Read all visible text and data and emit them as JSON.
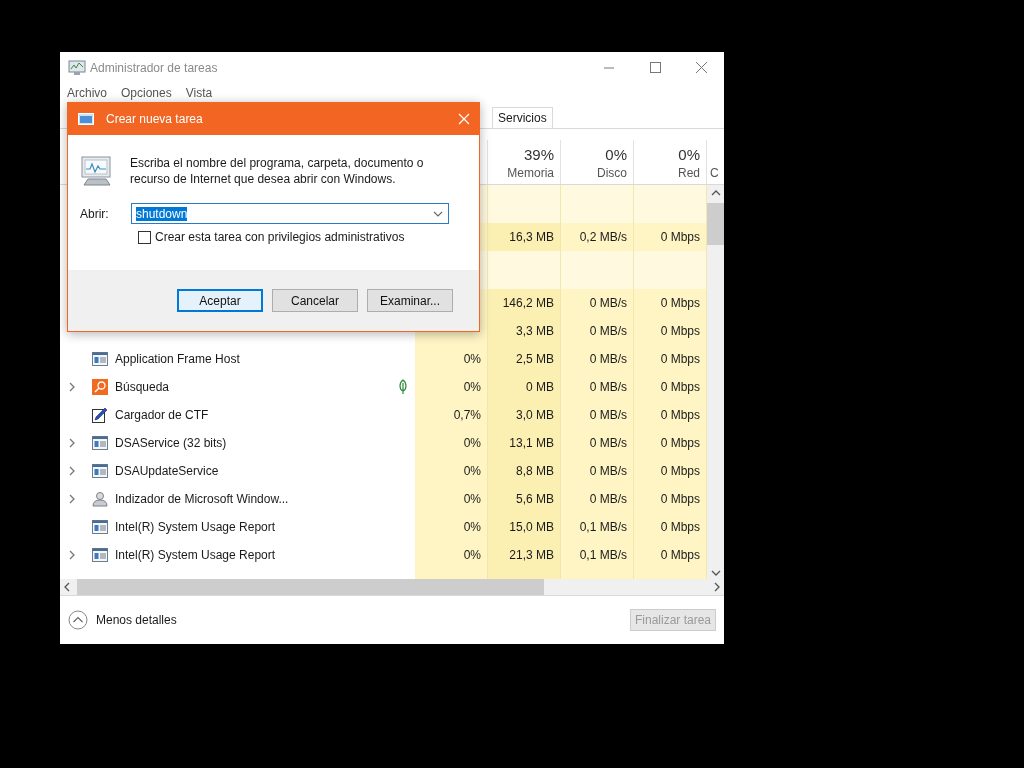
{
  "window": {
    "title": "Administrador de tareas"
  },
  "menu": [
    "Archivo",
    "Opciones",
    "Vista"
  ],
  "tabs": [
    {
      "label": "Servicios",
      "selected": false
    }
  ],
  "columns": [
    {
      "percent": "39%",
      "label": "Memoria"
    },
    {
      "percent": "0%",
      "label": "Disco"
    },
    {
      "percent": "0%",
      "label": "Red"
    },
    {
      "label": "C"
    }
  ],
  "rows": [
    {
      "kind": "group"
    },
    {
      "kind": "covered",
      "memory": "16,3 MB",
      "disk": "0,2 MB/s",
      "network": "0 Mbps"
    },
    {
      "kind": "group"
    },
    {
      "kind": "covered",
      "memory": "146,2 MB",
      "disk": "0 MB/s",
      "network": "0 Mbps"
    },
    {
      "kind": "covered",
      "memory": "3,3 MB",
      "disk": "0 MB/s",
      "network": "0 Mbps"
    },
    {
      "kind": "app",
      "name": "Application Frame Host",
      "expandable": false,
      "leaf": false,
      "cpu": "0%",
      "memory": "2,5 MB",
      "disk": "0 MB/s",
      "network": "0 Mbps"
    },
    {
      "kind": "search",
      "name": "Búsqueda",
      "expandable": true,
      "leaf": true,
      "cpu": "0%",
      "memory": "0 MB",
      "disk": "0 MB/s",
      "network": "0 Mbps"
    },
    {
      "kind": "pen",
      "name": "Cargador de CTF",
      "expandable": false,
      "leaf": false,
      "cpu": "0,7%",
      "memory": "3,0 MB",
      "disk": "0 MB/s",
      "network": "0 Mbps"
    },
    {
      "kind": "app",
      "name": "DSAService (32 bits)",
      "expandable": true,
      "leaf": false,
      "cpu": "0%",
      "memory": "13,1 MB",
      "disk": "0 MB/s",
      "network": "0 Mbps"
    },
    {
      "kind": "app",
      "name": "DSAUpdateService",
      "expandable": true,
      "leaf": false,
      "cpu": "0%",
      "memory": "8,8 MB",
      "disk": "0 MB/s",
      "network": "0 Mbps"
    },
    {
      "kind": "user",
      "name": "Indizador de Microsoft Window...",
      "expandable": true,
      "leaf": false,
      "cpu": "0%",
      "memory": "5,6 MB",
      "disk": "0 MB/s",
      "network": "0 Mbps"
    },
    {
      "kind": "app",
      "name": "Intel(R) System Usage Report",
      "expandable": false,
      "leaf": false,
      "cpu": "0%",
      "memory": "15,0 MB",
      "disk": "0,1 MB/s",
      "network": "0 Mbps"
    },
    {
      "kind": "app",
      "name": "Intel(R) System Usage Report",
      "expandable": true,
      "leaf": false,
      "cpu": "0%",
      "memory": "21,3 MB",
      "disk": "0,1 MB/s",
      "network": "0 Mbps"
    }
  ],
  "footer": {
    "toggle_label": "Menos detalles",
    "end_task": {
      "label": "Finalizar tarea",
      "disabled": true
    }
  },
  "dialog": {
    "title": "Crear nueva tarea",
    "message": "Escriba el nombre del programa, carpeta, documento o recurso de Internet que desea abrir con Windows.",
    "open_label": "Abrir:",
    "open_value": "shutdown",
    "value_selected": true,
    "admin_checkbox": {
      "label": "Crear esta tarea con privilegios administrativos",
      "checked": false
    },
    "buttons": [
      {
        "label": "Aceptar",
        "default": true
      },
      {
        "label": "Cancelar",
        "default": false
      },
      {
        "label": "Examinar...",
        "default": false
      }
    ]
  }
}
